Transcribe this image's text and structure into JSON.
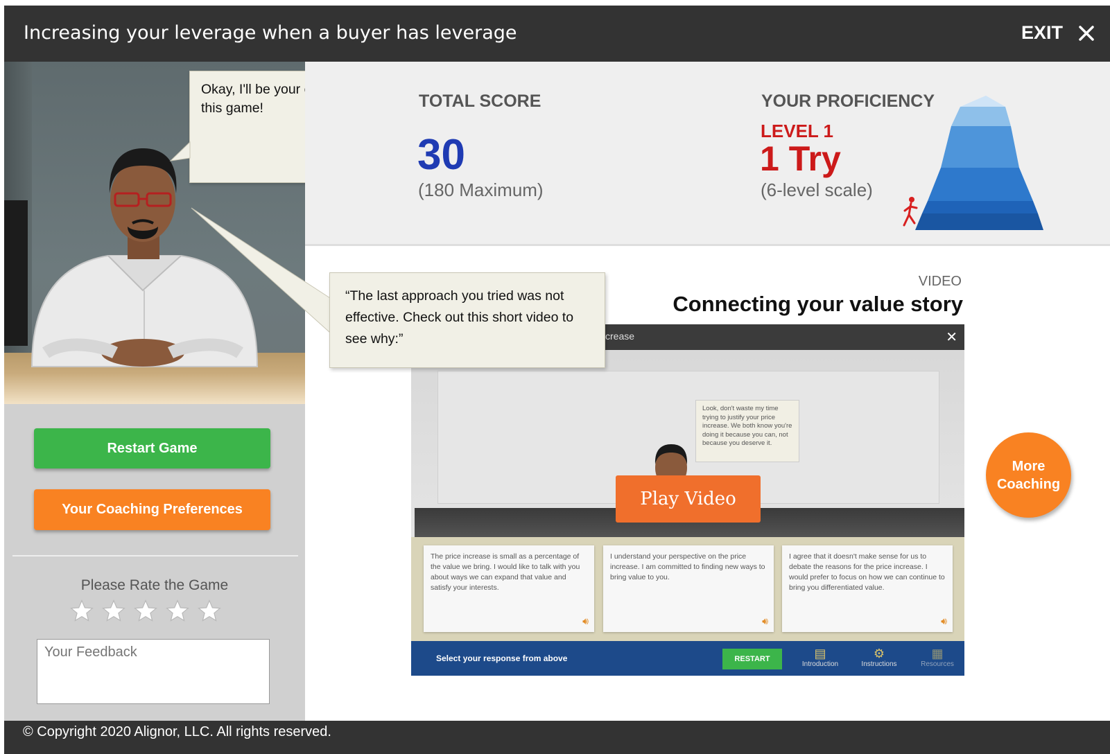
{
  "header": {
    "title": "Increasing your leverage when a buyer has leverage",
    "exit_label": "EXIT"
  },
  "coach": {
    "speech_intro": "Okay, I'll be your coach for this game!",
    "speech_feedback": "“The last approach you tried was not effective. Check out this short video to see why:”"
  },
  "sidebar": {
    "restart_label": "Restart Game",
    "prefs_label": "Your Coaching Preferences",
    "rate_label": "Please Rate the Game",
    "rating": {
      "value": 0,
      "max": 5
    },
    "feedback_placeholder": "Your Feedback"
  },
  "score": {
    "label": "TOTAL SCORE",
    "value": "30",
    "max_text": "(180 Maximum)"
  },
  "proficiency": {
    "label": "YOUR PROFICIENCY",
    "level": "LEVEL 1",
    "tries": "1 Try",
    "scale_text": "(6-level scale)",
    "current_level": 1,
    "levels": 6
  },
  "video": {
    "tag": "VIDEO",
    "title": "Connecting your value story",
    "window_title": "crease",
    "buyer_bubble": "Look, don't waste my time trying to justify your price increase. We both know you're doing it because you can, not because you deserve it.",
    "play_label": "Play Video",
    "choices": [
      "The price increase is small as a percentage of the value we bring. I would like to talk with you about ways we can expand that value and satisfy your interests.",
      "I understand your perspective on the price increase. I am committed to finding new ways to bring value to you.",
      "I agree that it doesn't make sense for us to debate the reasons for the price increase. I would prefer to focus on how we can continue to bring you differentiated value."
    ],
    "prompt": "Select your response from above",
    "restart_label": "RESTART",
    "nav": [
      "Introduction",
      "Instructions",
      "Resources"
    ]
  },
  "more_coaching": {
    "line1": "More",
    "line2": "Coaching"
  },
  "footer": {
    "copyright": "© Copyright 2020 Alignor, LLC. All rights reserved."
  }
}
